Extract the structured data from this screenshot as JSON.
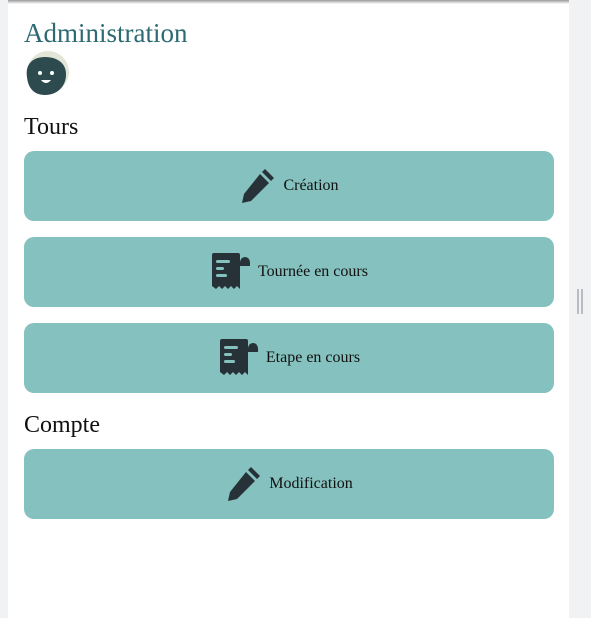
{
  "page": {
    "title": "Administration"
  },
  "sections": {
    "tours": {
      "title": "Tours",
      "buttons": {
        "creation": {
          "label": "Création",
          "icon": "pencil-icon"
        },
        "tournee": {
          "label": "Tournée en cours",
          "icon": "receipt-icon"
        },
        "etape": {
          "label": "Etape en cours",
          "icon": "receipt-icon"
        }
      }
    },
    "compte": {
      "title": "Compte",
      "buttons": {
        "modification": {
          "label": "Modification",
          "icon": "pencil-icon"
        }
      }
    }
  },
  "colors": {
    "accent": "#2d6a72",
    "button": "#85c1be",
    "icon": "#263238",
    "avatar_bg": "#e3e6d6",
    "avatar_face": "#2d4a4e"
  }
}
